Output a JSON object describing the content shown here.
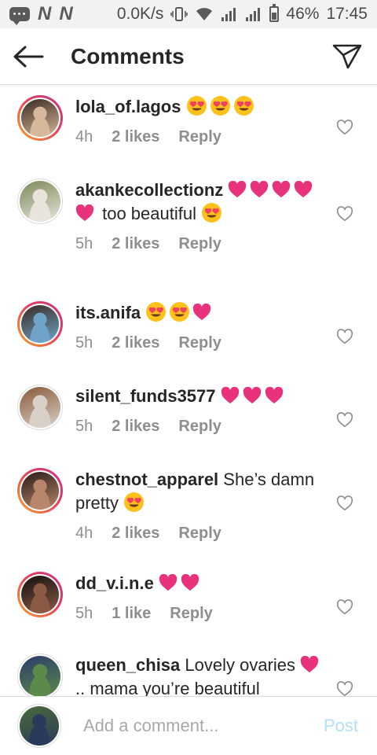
{
  "status_bar": {
    "speed": "0.0K/s",
    "battery": "46%",
    "time": "17:45",
    "carrier_icons": [
      "N",
      "N"
    ]
  },
  "header": {
    "title": "Comments"
  },
  "comments": [
    {
      "username": "lola_of.lagos",
      "segments": [
        {
          "e": "face"
        },
        {
          "e": "face"
        },
        {
          "e": "face"
        }
      ],
      "time": "4h",
      "likes": "2 likes",
      "reply": "Reply",
      "ring": true,
      "avatar_colors": [
        "#3a2a22",
        "#d8b89a"
      ]
    },
    {
      "username": "akankecollectionz",
      "segments": [
        {
          "e": "heart"
        },
        {
          "e": "heart"
        },
        {
          "e": "heart"
        },
        {
          "e": "heart"
        },
        {
          "e": "heart"
        },
        {
          "t": " too beautiful "
        },
        {
          "e": "face"
        }
      ],
      "time": "5h",
      "likes": "2 likes",
      "reply": "Reply",
      "ring": false,
      "avatar_colors": [
        "#7c8a5a",
        "#e8e4dc"
      ]
    },
    {
      "username": "its.anifa",
      "segments": [
        {
          "e": "face"
        },
        {
          "e": "face"
        },
        {
          "e": "heart"
        }
      ],
      "time": "5h",
      "likes": "2 likes",
      "reply": "Reply",
      "ring": true,
      "avatar_colors": [
        "#3a2a22",
        "#6fa3c8"
      ]
    },
    {
      "username": "silent_funds3577",
      "segments": [
        {
          "e": "heart"
        },
        {
          "e": "heart"
        },
        {
          "e": "heart"
        }
      ],
      "time": "5h",
      "likes": "2 likes",
      "reply": "Reply",
      "ring": false,
      "avatar_colors": [
        "#8a5a3a",
        "#d9d0c8"
      ]
    },
    {
      "username": "chestnot_apparel",
      "segments": [
        {
          "t": "She’s damn pretty "
        },
        {
          "e": "face"
        }
      ],
      "time": "4h",
      "likes": "2 likes",
      "reply": "Reply",
      "ring": true,
      "avatar_colors": [
        "#2a1c18",
        "#b8866a"
      ]
    },
    {
      "username": "dd_v.i.n.e",
      "segments": [
        {
          "e": "heart"
        },
        {
          "e": "heart"
        }
      ],
      "time": "5h",
      "likes": "1 like",
      "reply": "Reply",
      "ring": true,
      "avatar_colors": [
        "#141010",
        "#8a5a44"
      ]
    },
    {
      "username": "queen_chisa",
      "segments": [
        {
          "t": "Lovely ovaries "
        },
        {
          "e": "heart"
        },
        {
          "t": ".. mama you’re beautiful"
        }
      ],
      "time": "",
      "likes": "",
      "reply": "",
      "ring": false,
      "avatar_colors": [
        "#2a3a6a",
        "#5c8a4a"
      ]
    }
  ],
  "footer": {
    "placeholder": "Add a comment...",
    "post_label": "Post",
    "avatar_colors": [
      "#4a6a3a",
      "#2a3a5a"
    ]
  },
  "colors": {
    "meta": "#8e8e8e",
    "heart_emoji": "#e8327c",
    "post": "#b2dffc"
  }
}
